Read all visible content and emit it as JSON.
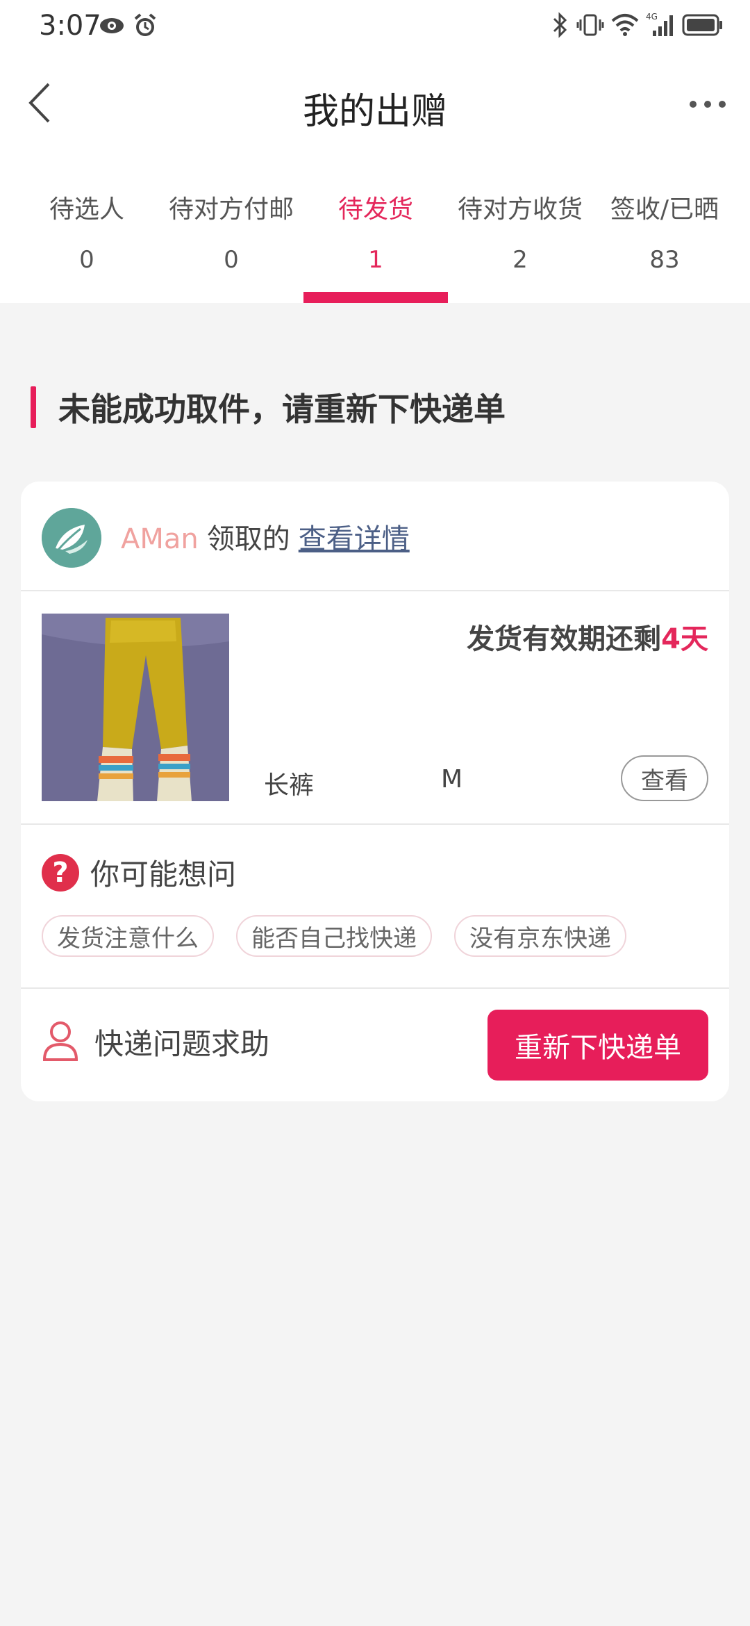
{
  "status_bar": {
    "time": "3:07",
    "left_icons": [
      "eye-icon",
      "alarm-icon"
    ],
    "right_icons": [
      "bluetooth-icon",
      "vibrate-icon",
      "wifi-icon",
      "signal-4g-icon",
      "battery-icon"
    ],
    "network_label": "4G"
  },
  "header": {
    "back_icon": "chevron-left-icon",
    "title": "我的出赠",
    "more_icon": "more-horizontal-icon"
  },
  "tabs": [
    {
      "label": "待选人",
      "count": "0",
      "active": false
    },
    {
      "label": "待对方付邮",
      "count": "0",
      "active": false
    },
    {
      "label": "待发货",
      "count": "1",
      "active": true
    },
    {
      "label": "待对方收货",
      "count": "2",
      "active": false
    },
    {
      "label": "签收/已晒",
      "count": "83",
      "active": false
    }
  ],
  "section": {
    "heading": "未能成功取件，请重新下快递单"
  },
  "card": {
    "receiver": {
      "name": "AMan",
      "suffix": "领取的",
      "details_link": "查看详情"
    },
    "item": {
      "deadline_prefix": "发货有效期还剩",
      "deadline_days": "4天",
      "name": "长裤",
      "size": "M",
      "view_button": "查看"
    },
    "faq": {
      "title": "你可能想问",
      "icon": "question-circle-icon",
      "chips": [
        "发货注意什么",
        "能否自己找快递",
        "没有京东快递"
      ]
    },
    "help": {
      "icon": "person-icon",
      "label": "快递问题求助",
      "button": "重新下快递单"
    }
  },
  "colors": {
    "accent": "#e71e5a",
    "receiver_name": "#f0a29f",
    "link": "#4c5f86",
    "background": "#f4f4f4"
  }
}
